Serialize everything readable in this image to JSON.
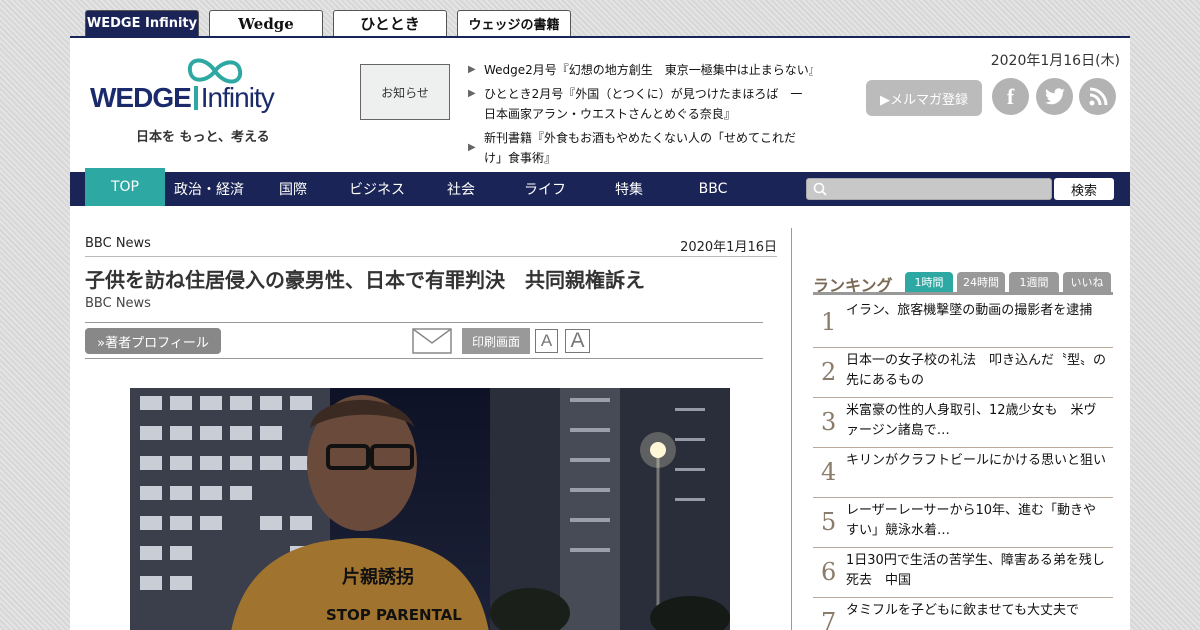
{
  "site_tabs": [
    {
      "label": "WEDGE Infinity",
      "active": true
    },
    {
      "label": "Wedge",
      "active": false
    },
    {
      "label": "ひととき",
      "active": false
    },
    {
      "label": "ウェッジの書籍",
      "active": false
    }
  ],
  "header": {
    "logo_text_a": "WEDGE",
    "logo_text_b": "Infinity",
    "logo_tagline": "日本を もっと、考える",
    "notice_label": "お知らせ",
    "news": [
      "Wedge2月号『幻想の地方創生　東京一極集中は止まらない』",
      "ひととき2月号『外国（とつくに）が見つけたまほろば　一日本画家アラン・ウエストさんとめぐる奈良』",
      "新刊書籍『外食もお酒もやめたくない人の「せめてこれだけ」食事術』"
    ],
    "date": "2020年1月16日(木)",
    "mail_label": "▶メルマガ登録"
  },
  "nav": {
    "items": [
      "TOP",
      "政治・経済",
      "国際",
      "ビジネス",
      "社会",
      "ライフ",
      "特集",
      "BBC"
    ],
    "active_index": 0,
    "search_placeholder": "",
    "search_button": "検索"
  },
  "article": {
    "source": "BBC News",
    "date": "2020年1月16日",
    "title": "子供を訪ね住居侵入の豪男性、日本で有罪判決　共同親権訴え",
    "author": "BBC News",
    "profile_button": "»著者プロフィール",
    "print_button": "印刷画面",
    "font_small": "A",
    "font_large": "A",
    "photo_shirt_text_1": "片親誘拐",
    "photo_shirt_text_2": "STOP PARENTAL"
  },
  "ranking": {
    "title": "ランキング",
    "tabs": [
      "1時間",
      "24時間",
      "1週間",
      "いいね"
    ],
    "active_tab": 0,
    "items": [
      {
        "rank": "1",
        "text": "イラン、旅客機撃墜の動画の撮影者を逮捕"
      },
      {
        "rank": "2",
        "text": "日本一の女子校の礼法　叩き込んだ〝型〟の先にあるもの"
      },
      {
        "rank": "3",
        "text": "米富豪の性的人身取引、12歳少女も　米ヴァージン諸島で…"
      },
      {
        "rank": "4",
        "text": "キリンがクラフトビールにかける思いと狙い"
      },
      {
        "rank": "5",
        "text": "レーザーレーサーから10年、進む「動きやすい」競泳水着…"
      },
      {
        "rank": "6",
        "text": "1日30円で生活の苦学生、障害ある弟を残し死去　中国"
      },
      {
        "rank": "7",
        "text": "タミフルを子どもに飲ませても大丈夫で"
      }
    ]
  },
  "colors": {
    "navy": "#1b2456",
    "teal": "#2ea8a2",
    "gray_button": "#888888"
  }
}
